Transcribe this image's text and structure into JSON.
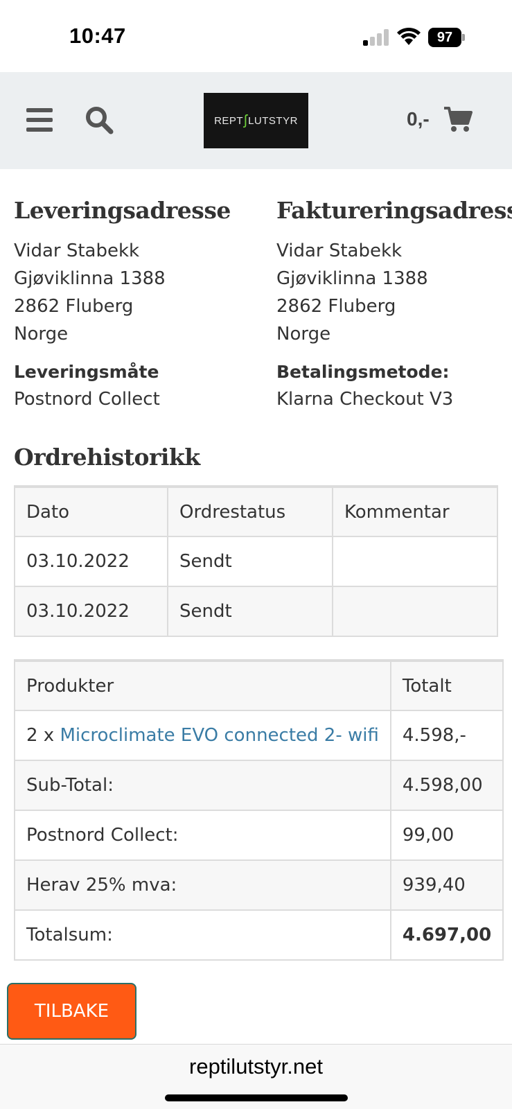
{
  "status_bar": {
    "time": "10:47",
    "battery": "97"
  },
  "header": {
    "logo_text_left": "REPT",
    "logo_text_right": "LUTSTYR",
    "cart_total": "0,-"
  },
  "delivery": {
    "title": "Leveringsadresse",
    "lines": [
      "Vidar Stabekk",
      "Gjøviklinna 1388",
      "2862 Fluberg",
      "Norge"
    ],
    "method_label": "Leveringsmåte",
    "method_value": "Postnord Collect"
  },
  "billing": {
    "title": "Faktureringsadresse",
    "lines": [
      "Vidar Stabekk",
      "Gjøviklinna 1388",
      "2862 Fluberg",
      "Norge"
    ],
    "method_label": "Betalingsmetode:",
    "method_value": "Klarna Checkout V3"
  },
  "history": {
    "title": "Ordrehistorikk",
    "headers": [
      "Dato",
      "Ordrestatus",
      "Kommentar"
    ],
    "rows": [
      {
        "date": "03.10.2022",
        "status": "Sendt",
        "comment": ""
      },
      {
        "date": "03.10.2022",
        "status": "Sendt",
        "comment": ""
      }
    ]
  },
  "products": {
    "headers": [
      "Produkter",
      "Totalt"
    ],
    "items": [
      {
        "qty": "2 x",
        "name": "Microclimate EVO connected 2- wifi",
        "total": "4.598,-"
      }
    ],
    "summary": [
      {
        "label": "Sub-Total:",
        "value": "4.598,00"
      },
      {
        "label": "Postnord Collect:",
        "value": "99,00"
      },
      {
        "label": "Herav 25% mva:",
        "value": "939,40"
      },
      {
        "label": "Totalsum:",
        "value": "4.697,00"
      }
    ]
  },
  "back_button": "TILBAKE",
  "browser": {
    "url": "reptilutstyr.net"
  },
  "colors": {
    "accent": "#ff5a14",
    "link": "#3a7ca5",
    "header_bg": "#eceff1"
  }
}
